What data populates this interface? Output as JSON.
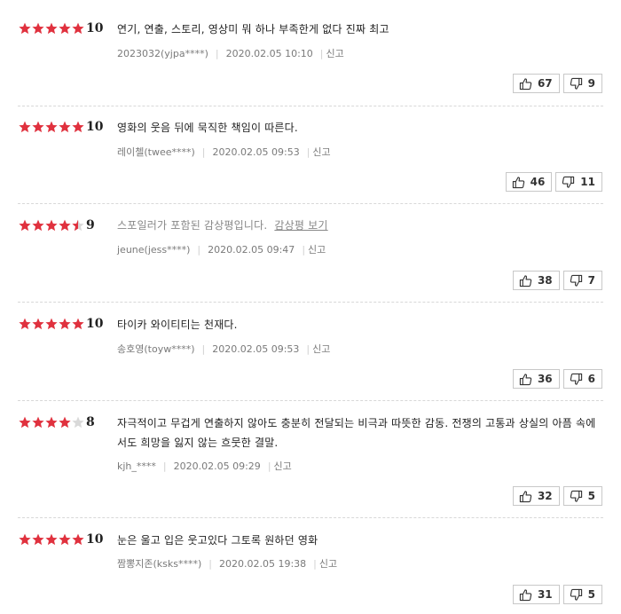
{
  "reviews": [
    {
      "score": "10",
      "stars": 5,
      "text": "연기, 연출, 스토리, 영상미 뭐 하나 부족한게 없다 진짜 최고",
      "spoiler": false,
      "author": "2023032(yjpa****)",
      "datetime": "2020.02.05 10:10",
      "report": "신고",
      "likes": "67",
      "dislikes": "9"
    },
    {
      "score": "10",
      "stars": 5,
      "text": "영화의 웃음 뒤에 묵직한 책임이 따른다.",
      "spoiler": false,
      "author": "레이첼(twee****)",
      "datetime": "2020.02.05 09:53",
      "report": "신고",
      "likes": "46",
      "dislikes": "11"
    },
    {
      "score": "9",
      "stars": 4.5,
      "text": "스포일러가 포함된 감상평입니다.",
      "spoiler": true,
      "spoiler_link": "감상평 보기",
      "author": "jeune(jess****)",
      "datetime": "2020.02.05 09:47",
      "report": "신고",
      "likes": "38",
      "dislikes": "7"
    },
    {
      "score": "10",
      "stars": 5,
      "text": "타이카 와이티티는 천재다.",
      "spoiler": false,
      "author": "송호영(toyw****)",
      "datetime": "2020.02.05 09:53",
      "report": "신고",
      "likes": "36",
      "dislikes": "6"
    },
    {
      "score": "8",
      "stars": 4,
      "text": "자극적이고 무겁게 연출하지 않아도 충분히 전달되는 비극과 따뜻한 감동. 전쟁의 고통과 상실의 아픔 속에서도 희망을 잃지 않는 흐뭇한 결말.",
      "spoiler": false,
      "author": "kjh_****",
      "datetime": "2020.02.05 09:29",
      "report": "신고",
      "likes": "32",
      "dislikes": "5"
    },
    {
      "score": "10",
      "stars": 5,
      "text": "눈은 울고 입은 웃고있다 그토록 원하던 영화",
      "spoiler": false,
      "author": "짬뽕지존(ksks****)",
      "datetime": "2020.02.05 19:38",
      "report": "신고",
      "likes": "31",
      "dislikes": "5"
    }
  ],
  "colors": {
    "star_filled": "#e0313e",
    "star_empty": "#d9d9d9",
    "border": "#c8c8c8",
    "meta": "#7a7a7a"
  },
  "icons": {
    "thumb_up": "thumb-up-icon",
    "thumb_down": "thumb-down-icon",
    "star": "star-icon"
  }
}
